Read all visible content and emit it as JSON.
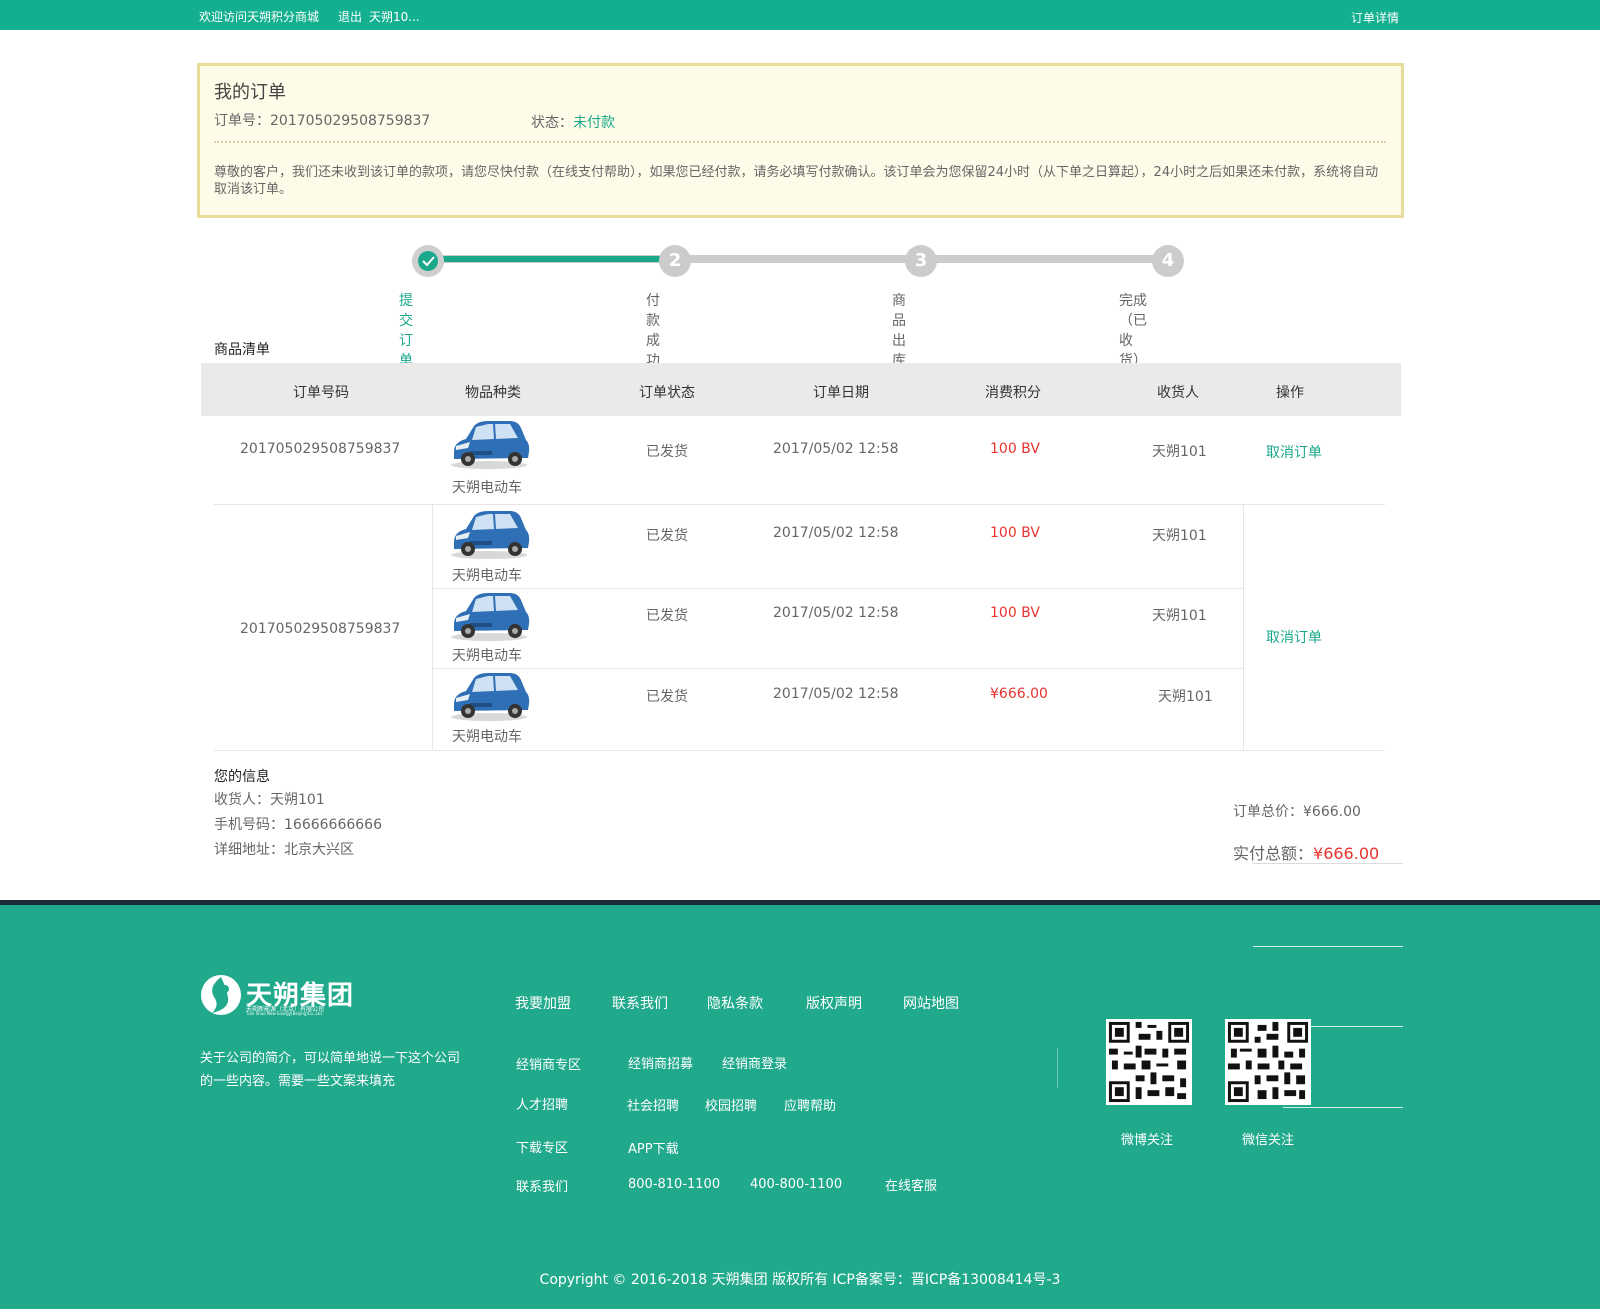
{
  "topbar": {
    "welcome": "欢迎访问天朔积分商城",
    "logout": "退出",
    "user": "天朔10...",
    "detail": "订单详情"
  },
  "notice": {
    "title": "我的订单",
    "order_no": "订单号：201705029508759837",
    "state_label": "状态：",
    "state_value": "未付款",
    "message": "尊敬的客户，我们还未收到该订单的款项，请您尽快付款（在线支付帮助），如果您已经付款，请务必填写付款确认。该订单会为您保留24小时（从下单之日算起），24小时之后如果还未付款，系统将自动取消该订单。"
  },
  "steps": [
    {
      "num": "",
      "label": "提交订单",
      "done": true
    },
    {
      "num": "2",
      "label": "付款成功",
      "done": false
    },
    {
      "num": "3",
      "label": "商品出库",
      "done": false
    },
    {
      "num": "4",
      "label": "完成（已收货）",
      "done": false
    }
  ],
  "goods": {
    "title": "商品清单",
    "headers": [
      "订单号码",
      "物品种类",
      "订单状态",
      "订单日期",
      "消费积分",
      "收货人",
      "操作"
    ],
    "orders": [
      {
        "order_no": "201705029508759837",
        "action": "取消订单",
        "items": [
          {
            "product": "天朔电动车",
            "status": "已发货",
            "date": "2017/05/02  12:58",
            "points": "100 BV",
            "receiver": "天朔101"
          }
        ]
      },
      {
        "order_no": "201705029508759837",
        "action": "取消订单",
        "items": [
          {
            "product": "天朔电动车",
            "status": "已发货",
            "date": "2017/05/02  12:58",
            "points": "100 BV",
            "receiver": "天朔101"
          },
          {
            "product": "天朔电动车",
            "status": "已发货",
            "date": "2017/05/02  12:58",
            "points": "100 BV",
            "receiver": "天朔101"
          },
          {
            "product": "天朔电动车",
            "status": "已发货",
            "date": "2017/05/02  12:58",
            "points": "¥666.00",
            "receiver": "天朔101"
          }
        ]
      }
    ]
  },
  "info": {
    "title": "您的信息",
    "receiver": "收货人：天朔101",
    "phone": "手机号码：16666666666",
    "address": "详细地址：北京大兴区",
    "total": "订单总价：¥666.00",
    "paid_label": "实付总额：",
    "paid_value": "¥666.00"
  },
  "footer": {
    "brand": "天朔集团",
    "brand_sub": "天朔新能源（北京）有限公司",
    "brand_sub_en": "Tian Shuo New Energy(Beijing)Co.,Ltd.",
    "about": "关于公司的简介，可以简单地说一下这个公司的一些内容。需要一些文案来填充",
    "nav": [
      "我要加盟",
      "联系我们",
      "隐私条款",
      "版权声明",
      "网站地图"
    ],
    "rows": [
      {
        "label": "经销商专区",
        "links": [
          "经销商招募",
          "经销商登录"
        ]
      },
      {
        "label": "人才招聘",
        "links": [
          "社会招聘",
          "校园招聘",
          "应聘帮助"
        ]
      },
      {
        "label": "下载专区",
        "links": [
          "APP下载"
        ]
      },
      {
        "label": "联系我们",
        "links": [
          "800-810-1100",
          "400-800-1100",
          "在线客服"
        ]
      }
    ],
    "qr": [
      {
        "label": "微博关注"
      },
      {
        "label": "微信关注"
      }
    ],
    "copyright": "Copyright © 2016-2018 天朔集团 版权所有 ICP备案号：晋ICP备13008414号-3"
  },
  "colors": {
    "accent": "#1aa88b",
    "topbar": "#13b08f",
    "footer": "#21a98c",
    "price": "#e8332f",
    "notice_bg": "#fffbe9"
  }
}
